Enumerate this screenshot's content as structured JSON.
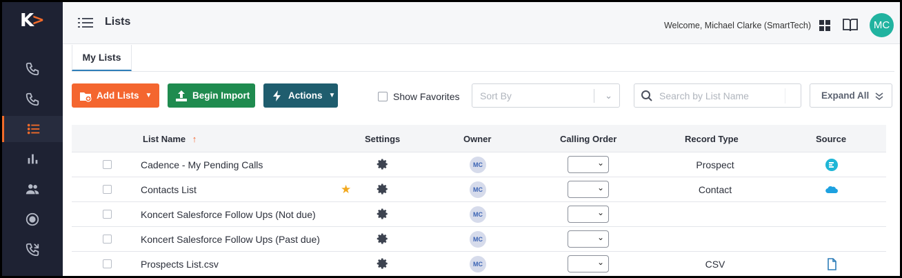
{
  "app": {
    "logo_letter": "K",
    "logo_arrow": ">"
  },
  "header": {
    "title": "Lists",
    "welcome": "Welcome, Michael Clarke (SmartTech)",
    "avatar_initials": "MC"
  },
  "sidebar": {
    "items": [
      {
        "icon": "phone-icon"
      },
      {
        "icon": "phone-icon"
      },
      {
        "icon": "list-icon",
        "active": true
      },
      {
        "icon": "bar-chart-icon"
      },
      {
        "icon": "people-icon"
      },
      {
        "icon": "record-icon"
      },
      {
        "icon": "phone-forward-icon"
      }
    ]
  },
  "tabs": [
    {
      "label": "My Lists",
      "active": true
    }
  ],
  "toolbar": {
    "add_lists": "Add Lists",
    "begin_import": "Begin Import",
    "actions": "Actions",
    "show_favorites": "Show Favorites",
    "sort_placeholder": "Sort By",
    "search_placeholder": "Search by List Name",
    "expand_all": "Expand All"
  },
  "table": {
    "columns": {
      "list_name": "List Name",
      "settings": "Settings",
      "owner": "Owner",
      "calling_order": "Calling Order",
      "record_type": "Record Type",
      "source": "Source"
    },
    "rows": [
      {
        "name": "Cadence - My Pending Calls",
        "favorite": false,
        "owner": "MC",
        "record_type": "Prospect",
        "source": "cadence-icon"
      },
      {
        "name": "Contacts List",
        "favorite": true,
        "owner": "MC",
        "record_type": "Contact",
        "source": "salesforce-icon"
      },
      {
        "name": "Koncert Salesforce Follow Ups (Not due)",
        "favorite": false,
        "owner": "MC",
        "record_type": "",
        "source": ""
      },
      {
        "name": "Koncert Salesforce Follow Ups (Past due)",
        "favorite": false,
        "owner": "MC",
        "record_type": "",
        "source": ""
      },
      {
        "name": "Prospects List.csv",
        "favorite": false,
        "owner": "MC",
        "record_type": "CSV",
        "source": "file-icon"
      }
    ]
  },
  "colors": {
    "sidebar_bg": "#1e2233",
    "accent_orange": "#f4662f",
    "import_green": "#1f8b4f",
    "actions_teal": "#1f5d6e",
    "avatar_teal": "#21b3a0",
    "star_gold": "#f2a81d"
  }
}
